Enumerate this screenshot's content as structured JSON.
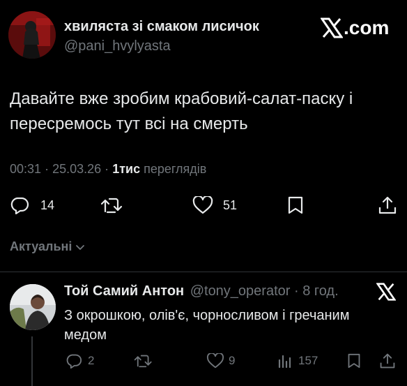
{
  "brand": {
    "logo": "X.com"
  },
  "post": {
    "author_name": "хвиляста зі смаком лисичок",
    "author_handle": "@pani_hvylyasta",
    "text_line1": "Давайте вже зробим крабовий-салат-паску і",
    "text_line2": "пересремось тут всі на смерть",
    "time": "00:31",
    "sep1": "·",
    "date": "25.03.26",
    "sep2": "·",
    "views_count": "1тис",
    "views_label": "переглядів",
    "actions": {
      "replies": "14",
      "reposts": "",
      "likes": "51"
    }
  },
  "sort": {
    "label": "Актуальні"
  },
  "reply": {
    "author_name": "Той Самий Антон",
    "author_handle": "@tony_operator",
    "time_ago": "· 8 год.",
    "text_line1": "З окрошкою, олів'є, чорносливом і гречаним",
    "text_line2": "медом",
    "actions": {
      "replies": "2",
      "likes": "9",
      "views": "157"
    }
  },
  "icons": [
    "avatar-image",
    "x-logo-icon",
    "reply-icon",
    "repost-icon",
    "like-icon",
    "bookmark-icon",
    "share-icon",
    "chevron-down-icon",
    "views-icon"
  ],
  "colors": {
    "background": "#000000",
    "text": "#e7e9ea",
    "muted": "#71767b",
    "divider": "#2f3336"
  }
}
